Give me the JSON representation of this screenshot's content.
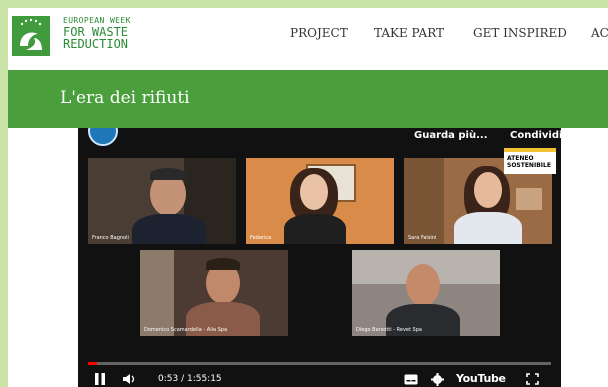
{
  "header": {
    "logo": {
      "line1": "EUROPEAN WEEK",
      "line2": "FOR WASTE",
      "line3": "REDUCTION"
    },
    "nav": [
      "PROJECT",
      "TAKE PART",
      "GET INSPIRED",
      "AC"
    ]
  },
  "page": {
    "title": "L'era dei rifiuti"
  },
  "video": {
    "watch_more": "Guarda più...",
    "share": "Condividi",
    "badge": {
      "line1": "ATENEO",
      "line2": "SOSTENIBILE"
    },
    "participants": [
      {
        "name": "Franco Bagnoli"
      },
      {
        "name": "Federica"
      },
      {
        "name": "Sara Falsini"
      },
      {
        "name": "Domenico Scamardella - Alia Spa"
      },
      {
        "name": "Diego Barsotti - Revet Spa"
      }
    ],
    "time": "0:53 / 1:55:15",
    "progress_fraction": 0.0077,
    "youtube": "YouTube"
  },
  "colors": {
    "green": "#4a9f3c",
    "brand": "#2c8b35",
    "background": "#c9e3a6"
  }
}
